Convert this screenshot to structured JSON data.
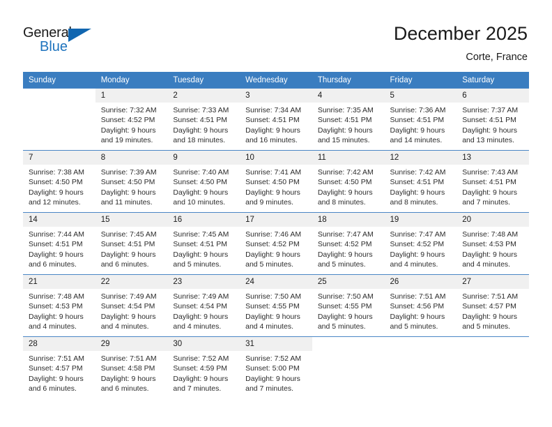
{
  "brand": {
    "name_top": "General",
    "name_bottom": "Blue",
    "flag_icon": "triangle-flag-icon",
    "colors": {
      "accent": "#1166b0",
      "text": "#1a1a1a"
    }
  },
  "header": {
    "title": "December 2025",
    "subtitle": "Corte, France"
  },
  "calendar": {
    "header_bg": "#3a7dc0",
    "daynum_bg": "#f0f0f0",
    "weekdays": [
      "Sunday",
      "Monday",
      "Tuesday",
      "Wednesday",
      "Thursday",
      "Friday",
      "Saturday"
    ],
    "weeks": [
      [
        {
          "day": "",
          "blank": true,
          "sunrise": "",
          "sunset": "",
          "daylight_1": "",
          "daylight_2": ""
        },
        {
          "day": "1",
          "sunrise": "Sunrise: 7:32 AM",
          "sunset": "Sunset: 4:52 PM",
          "daylight_1": "Daylight: 9 hours",
          "daylight_2": "and 19 minutes."
        },
        {
          "day": "2",
          "sunrise": "Sunrise: 7:33 AM",
          "sunset": "Sunset: 4:51 PM",
          "daylight_1": "Daylight: 9 hours",
          "daylight_2": "and 18 minutes."
        },
        {
          "day": "3",
          "sunrise": "Sunrise: 7:34 AM",
          "sunset": "Sunset: 4:51 PM",
          "daylight_1": "Daylight: 9 hours",
          "daylight_2": "and 16 minutes."
        },
        {
          "day": "4",
          "sunrise": "Sunrise: 7:35 AM",
          "sunset": "Sunset: 4:51 PM",
          "daylight_1": "Daylight: 9 hours",
          "daylight_2": "and 15 minutes."
        },
        {
          "day": "5",
          "sunrise": "Sunrise: 7:36 AM",
          "sunset": "Sunset: 4:51 PM",
          "daylight_1": "Daylight: 9 hours",
          "daylight_2": "and 14 minutes."
        },
        {
          "day": "6",
          "sunrise": "Sunrise: 7:37 AM",
          "sunset": "Sunset: 4:51 PM",
          "daylight_1": "Daylight: 9 hours",
          "daylight_2": "and 13 minutes."
        }
      ],
      [
        {
          "day": "7",
          "sunrise": "Sunrise: 7:38 AM",
          "sunset": "Sunset: 4:50 PM",
          "daylight_1": "Daylight: 9 hours",
          "daylight_2": "and 12 minutes."
        },
        {
          "day": "8",
          "sunrise": "Sunrise: 7:39 AM",
          "sunset": "Sunset: 4:50 PM",
          "daylight_1": "Daylight: 9 hours",
          "daylight_2": "and 11 minutes."
        },
        {
          "day": "9",
          "sunrise": "Sunrise: 7:40 AM",
          "sunset": "Sunset: 4:50 PM",
          "daylight_1": "Daylight: 9 hours",
          "daylight_2": "and 10 minutes."
        },
        {
          "day": "10",
          "sunrise": "Sunrise: 7:41 AM",
          "sunset": "Sunset: 4:50 PM",
          "daylight_1": "Daylight: 9 hours",
          "daylight_2": "and 9 minutes."
        },
        {
          "day": "11",
          "sunrise": "Sunrise: 7:42 AM",
          "sunset": "Sunset: 4:50 PM",
          "daylight_1": "Daylight: 9 hours",
          "daylight_2": "and 8 minutes."
        },
        {
          "day": "12",
          "sunrise": "Sunrise: 7:42 AM",
          "sunset": "Sunset: 4:51 PM",
          "daylight_1": "Daylight: 9 hours",
          "daylight_2": "and 8 minutes."
        },
        {
          "day": "13",
          "sunrise": "Sunrise: 7:43 AM",
          "sunset": "Sunset: 4:51 PM",
          "daylight_1": "Daylight: 9 hours",
          "daylight_2": "and 7 minutes."
        }
      ],
      [
        {
          "day": "14",
          "sunrise": "Sunrise: 7:44 AM",
          "sunset": "Sunset: 4:51 PM",
          "daylight_1": "Daylight: 9 hours",
          "daylight_2": "and 6 minutes."
        },
        {
          "day": "15",
          "sunrise": "Sunrise: 7:45 AM",
          "sunset": "Sunset: 4:51 PM",
          "daylight_1": "Daylight: 9 hours",
          "daylight_2": "and 6 minutes."
        },
        {
          "day": "16",
          "sunrise": "Sunrise: 7:45 AM",
          "sunset": "Sunset: 4:51 PM",
          "daylight_1": "Daylight: 9 hours",
          "daylight_2": "and 5 minutes."
        },
        {
          "day": "17",
          "sunrise": "Sunrise: 7:46 AM",
          "sunset": "Sunset: 4:52 PM",
          "daylight_1": "Daylight: 9 hours",
          "daylight_2": "and 5 minutes."
        },
        {
          "day": "18",
          "sunrise": "Sunrise: 7:47 AM",
          "sunset": "Sunset: 4:52 PM",
          "daylight_1": "Daylight: 9 hours",
          "daylight_2": "and 5 minutes."
        },
        {
          "day": "19",
          "sunrise": "Sunrise: 7:47 AM",
          "sunset": "Sunset: 4:52 PM",
          "daylight_1": "Daylight: 9 hours",
          "daylight_2": "and 4 minutes."
        },
        {
          "day": "20",
          "sunrise": "Sunrise: 7:48 AM",
          "sunset": "Sunset: 4:53 PM",
          "daylight_1": "Daylight: 9 hours",
          "daylight_2": "and 4 minutes."
        }
      ],
      [
        {
          "day": "21",
          "sunrise": "Sunrise: 7:48 AM",
          "sunset": "Sunset: 4:53 PM",
          "daylight_1": "Daylight: 9 hours",
          "daylight_2": "and 4 minutes."
        },
        {
          "day": "22",
          "sunrise": "Sunrise: 7:49 AM",
          "sunset": "Sunset: 4:54 PM",
          "daylight_1": "Daylight: 9 hours",
          "daylight_2": "and 4 minutes."
        },
        {
          "day": "23",
          "sunrise": "Sunrise: 7:49 AM",
          "sunset": "Sunset: 4:54 PM",
          "daylight_1": "Daylight: 9 hours",
          "daylight_2": "and 4 minutes."
        },
        {
          "day": "24",
          "sunrise": "Sunrise: 7:50 AM",
          "sunset": "Sunset: 4:55 PM",
          "daylight_1": "Daylight: 9 hours",
          "daylight_2": "and 4 minutes."
        },
        {
          "day": "25",
          "sunrise": "Sunrise: 7:50 AM",
          "sunset": "Sunset: 4:55 PM",
          "daylight_1": "Daylight: 9 hours",
          "daylight_2": "and 5 minutes."
        },
        {
          "day": "26",
          "sunrise": "Sunrise: 7:51 AM",
          "sunset": "Sunset: 4:56 PM",
          "daylight_1": "Daylight: 9 hours",
          "daylight_2": "and 5 minutes."
        },
        {
          "day": "27",
          "sunrise": "Sunrise: 7:51 AM",
          "sunset": "Sunset: 4:57 PM",
          "daylight_1": "Daylight: 9 hours",
          "daylight_2": "and 5 minutes."
        }
      ],
      [
        {
          "day": "28",
          "sunrise": "Sunrise: 7:51 AM",
          "sunset": "Sunset: 4:57 PM",
          "daylight_1": "Daylight: 9 hours",
          "daylight_2": "and 6 minutes."
        },
        {
          "day": "29",
          "sunrise": "Sunrise: 7:51 AM",
          "sunset": "Sunset: 4:58 PM",
          "daylight_1": "Daylight: 9 hours",
          "daylight_2": "and 6 minutes."
        },
        {
          "day": "30",
          "sunrise": "Sunrise: 7:52 AM",
          "sunset": "Sunset: 4:59 PM",
          "daylight_1": "Daylight: 9 hours",
          "daylight_2": "and 7 minutes."
        },
        {
          "day": "31",
          "sunrise": "Sunrise: 7:52 AM",
          "sunset": "Sunset: 5:00 PM",
          "daylight_1": "Daylight: 9 hours",
          "daylight_2": "and 7 minutes."
        },
        {
          "day": "",
          "blank": true,
          "sunrise": "",
          "sunset": "",
          "daylight_1": "",
          "daylight_2": ""
        },
        {
          "day": "",
          "blank": true,
          "sunrise": "",
          "sunset": "",
          "daylight_1": "",
          "daylight_2": ""
        },
        {
          "day": "",
          "blank": true,
          "sunrise": "",
          "sunset": "",
          "daylight_1": "",
          "daylight_2": ""
        }
      ]
    ]
  }
}
